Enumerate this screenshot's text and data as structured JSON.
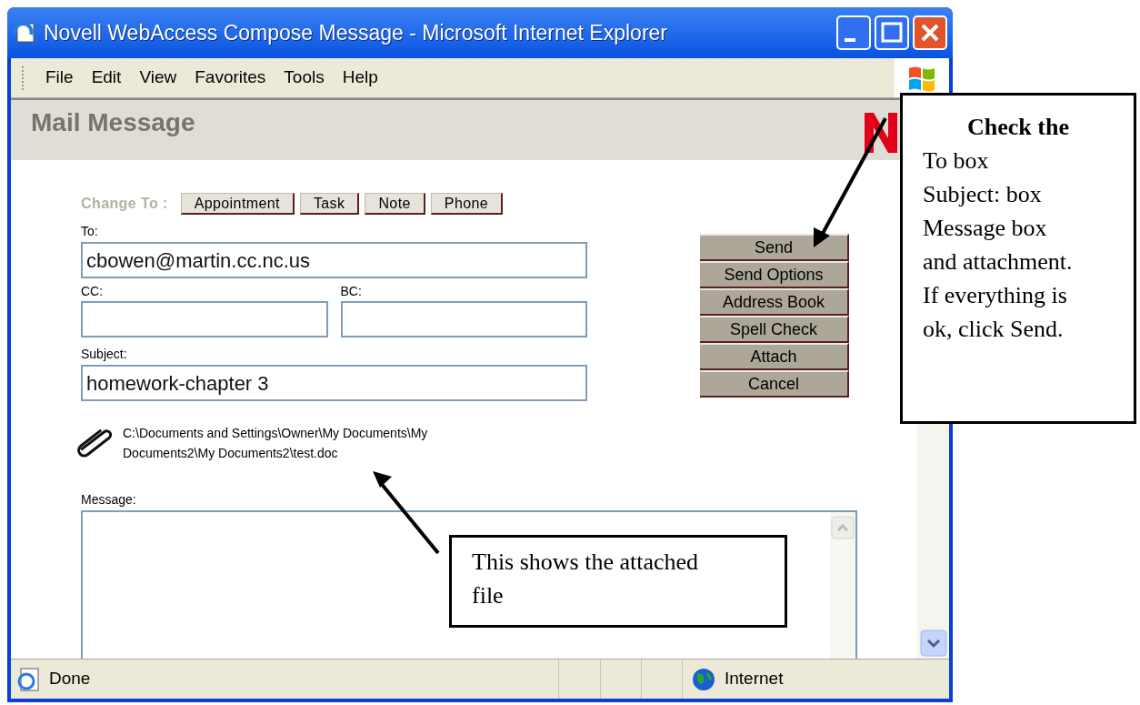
{
  "window": {
    "title": "Novell WebAccess Compose Message - Microsoft Internet Explorer"
  },
  "menu_bar": [
    "File",
    "Edit",
    "View",
    "Favorites",
    "Tools",
    "Help"
  ],
  "page_header": {
    "title": "Mail Message"
  },
  "change_to": {
    "label": "Change To :",
    "buttons": [
      "Appointment",
      "Task",
      "Note",
      "Phone"
    ]
  },
  "form": {
    "to": {
      "label": "To:",
      "value": "cbowen@martin.cc.nc.us"
    },
    "cc": {
      "label": "CC:"
    },
    "bc": {
      "label": "BC:"
    },
    "subject": {
      "label": "Subject:",
      "value": "homework-chapter 3"
    },
    "attachment": {
      "path": "C:\\Documents and Settings\\Owner\\My Documents\\My Documents2\\My Documents2\\test.doc"
    },
    "message": {
      "label": "Message:"
    }
  },
  "actions": [
    "Send",
    "Send Options",
    "Address Book",
    "Spell Check",
    "Attach",
    "Cancel"
  ],
  "status_bar": {
    "text": "Done",
    "zone": "Internet"
  },
  "callouts": [
    {
      "title": "Check the",
      "lines": [
        "To box",
        "Subject: box",
        "Message box",
        "and attachment.",
        "If everything is",
        "ok, click Send."
      ]
    },
    {
      "lines": [
        "This shows the attached",
        "file"
      ]
    }
  ]
}
